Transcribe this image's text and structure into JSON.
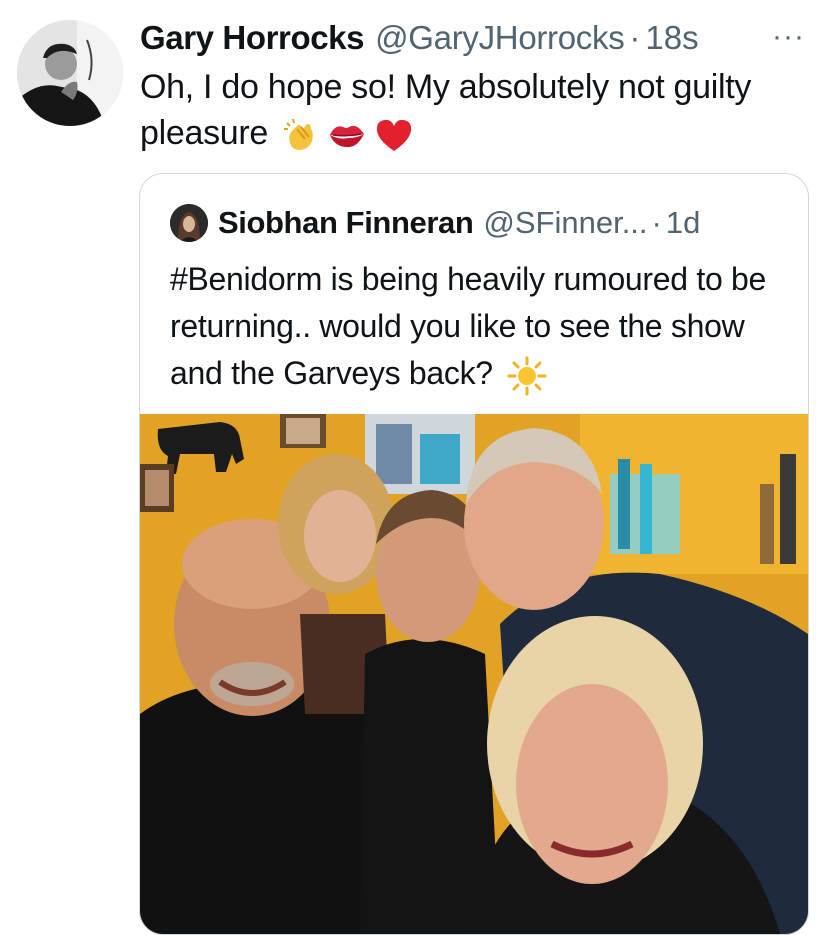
{
  "tweet": {
    "author_name": "Gary Horrocks",
    "author_handle": "@GaryJHorrocks",
    "separator": "·",
    "timestamp": "18s",
    "more_label": "···",
    "text": "Oh, I do hope so! My absolutely not guilty pleasure",
    "emojis": [
      "clapping-hands",
      "kiss-mark",
      "red-heart"
    ]
  },
  "quote": {
    "author_name": "Siobhan Finneran",
    "author_handle": "@SFinner...",
    "separator": "·",
    "timestamp": "1d",
    "text": "#Benidorm is being heavily rumoured to be returning.. would you like to see the show and the Garveys back?",
    "emoji": "sun",
    "photo_description_icon": "group-selfie-photo"
  },
  "colors": {
    "text": "#0f1419",
    "secondary": "#536471",
    "border": "#cfd9de",
    "wall": "#e7a92a"
  }
}
